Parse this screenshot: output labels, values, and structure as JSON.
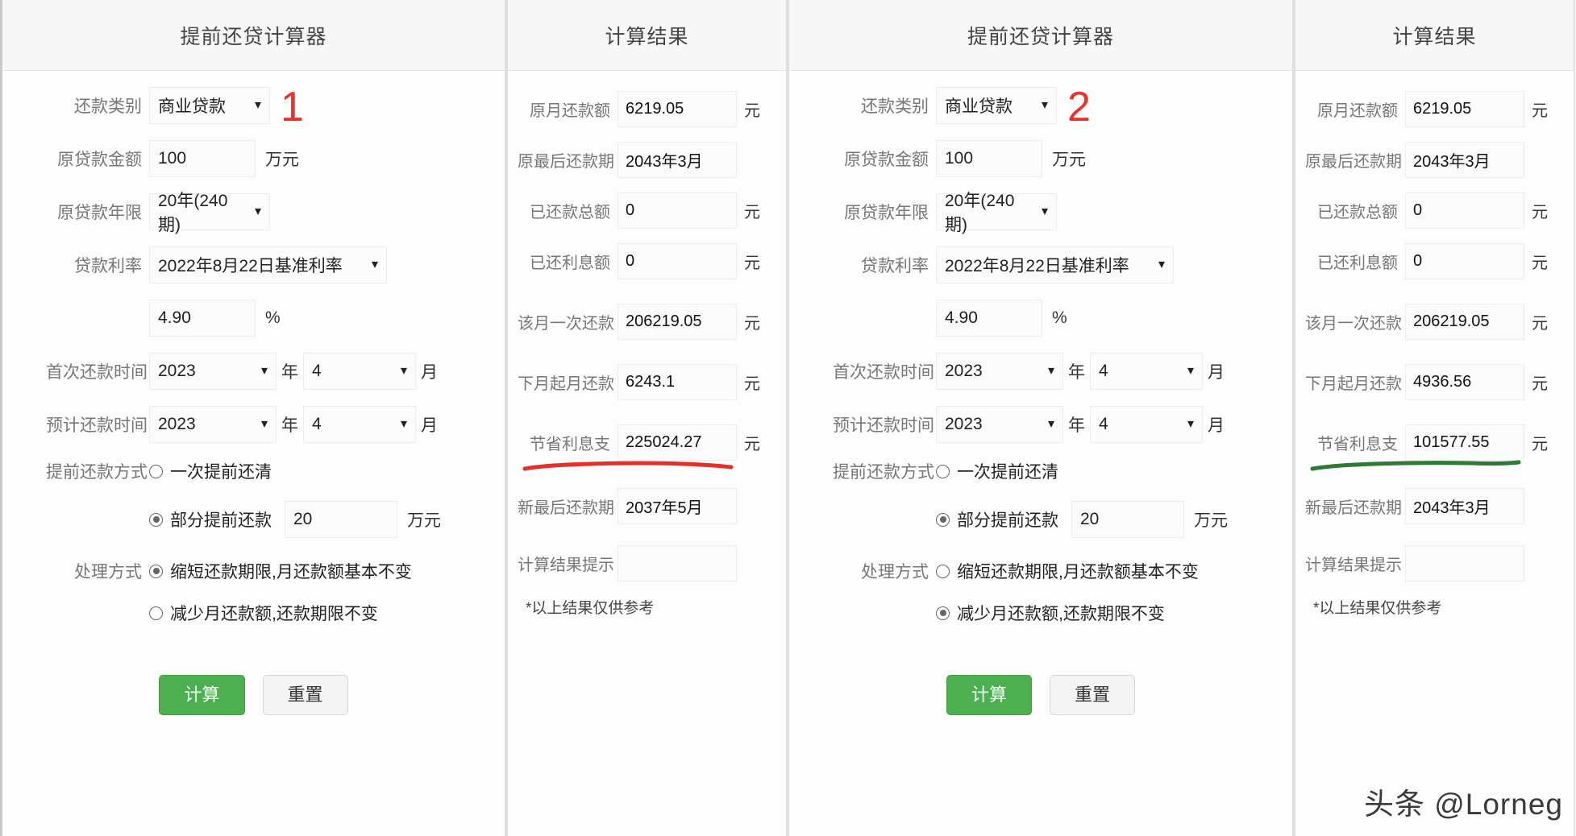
{
  "panels": [
    {
      "id": "form-1",
      "title": "提前还贷计算器",
      "marker": "1",
      "fields": {
        "category_label": "还款类别",
        "category_value": "商业贷款",
        "amount_label": "原贷款金额",
        "amount_value": "100",
        "amount_unit": "万元",
        "term_label": "原贷款年限",
        "term_value": "20年(240期)",
        "rate_label": "贷款利率",
        "rate_value": "2022年8月22日基准利率",
        "rate_pct_value": "4.90",
        "rate_pct_unit": "%",
        "first_pay_label": "首次还款时间",
        "first_pay_year": "2023",
        "first_pay_year_unit": "年",
        "first_pay_month": "4",
        "first_pay_month_unit": "月",
        "expected_pay_label": "预计还款时间",
        "expected_pay_year": "2023",
        "expected_pay_year_unit": "年",
        "expected_pay_month": "4",
        "expected_pay_month_unit": "月",
        "prepay_method_label": "提前还款方式",
        "prepay_option_full": "一次提前还清",
        "prepay_option_full_selected": false,
        "prepay_option_part": "部分提前还款",
        "prepay_option_part_selected": true,
        "prepay_part_amount": "20",
        "prepay_part_unit": "万元",
        "handle_label": "处理方式",
        "handle_option_shorten": "缩短还款期限,月还款额基本不变",
        "handle_option_shorten_selected": true,
        "handle_option_reduce": "减少月还款额,还款期限不变",
        "handle_option_reduce_selected": false,
        "calc_button": "计算",
        "reset_button": "重置"
      }
    },
    {
      "id": "form-2",
      "title": "提前还贷计算器",
      "marker": "2",
      "fields": {
        "category_label": "还款类别",
        "category_value": "商业贷款",
        "amount_label": "原贷款金额",
        "amount_value": "100",
        "amount_unit": "万元",
        "term_label": "原贷款年限",
        "term_value": "20年(240期)",
        "rate_label": "贷款利率",
        "rate_value": "2022年8月22日基准利率",
        "rate_pct_value": "4.90",
        "rate_pct_unit": "%",
        "first_pay_label": "首次还款时间",
        "first_pay_year": "2023",
        "first_pay_year_unit": "年",
        "first_pay_month": "4",
        "first_pay_month_unit": "月",
        "expected_pay_label": "预计还款时间",
        "expected_pay_year": "2023",
        "expected_pay_year_unit": "年",
        "expected_pay_month": "4",
        "expected_pay_month_unit": "月",
        "prepay_method_label": "提前还款方式",
        "prepay_option_full": "一次提前还清",
        "prepay_option_full_selected": false,
        "prepay_option_part": "部分提前还款",
        "prepay_option_part_selected": true,
        "prepay_part_amount": "20",
        "prepay_part_unit": "万元",
        "handle_label": "处理方式",
        "handle_option_shorten": "缩短还款期限,月还款额基本不变",
        "handle_option_shorten_selected": false,
        "handle_option_reduce": "减少月还款额,还款期限不变",
        "handle_option_reduce_selected": true,
        "calc_button": "计算",
        "reset_button": "重置"
      }
    }
  ],
  "results": [
    {
      "id": "result-1",
      "title": "计算结果",
      "note": "*以上结果仅供参考",
      "underline_color": "#e33127",
      "underline_after_index": 6,
      "rows": [
        {
          "label": "原月还款额",
          "value": "6219.05",
          "unit": "元"
        },
        {
          "label": "原最后还款期",
          "value": "2043年3月",
          "unit": ""
        },
        {
          "label": "已还款总额",
          "value": "0",
          "unit": "元"
        },
        {
          "label": "已还利息额",
          "value": "0",
          "unit": "元"
        },
        {
          "label": "该月一次还款",
          "value": "206219.05",
          "unit": "元"
        },
        {
          "label": "下月起月还款",
          "value": "6243.1",
          "unit": "元"
        },
        {
          "label": "节省利息支",
          "value": "225024.27",
          "unit": "元"
        },
        {
          "label": "新最后还款期",
          "value": "2037年5月",
          "unit": ""
        },
        {
          "label": "计算结果提示",
          "value": "",
          "unit": ""
        }
      ]
    },
    {
      "id": "result-2",
      "title": "计算结果",
      "note": "*以上结果仅供参考",
      "underline_color": "#2d7a33",
      "underline_after_index": 6,
      "rows": [
        {
          "label": "原月还款额",
          "value": "6219.05",
          "unit": "元"
        },
        {
          "label": "原最后还款期",
          "value": "2043年3月",
          "unit": ""
        },
        {
          "label": "已还款总额",
          "value": "0",
          "unit": "元"
        },
        {
          "label": "已还利息额",
          "value": "0",
          "unit": "元"
        },
        {
          "label": "该月一次还款",
          "value": "206219.05",
          "unit": "元"
        },
        {
          "label": "下月起月还款",
          "value": "4936.56",
          "unit": "元"
        },
        {
          "label": "节省利息支",
          "value": "101577.55",
          "unit": "元"
        },
        {
          "label": "新最后还款期",
          "value": "2043年3月",
          "unit": ""
        },
        {
          "label": "计算结果提示",
          "value": "",
          "unit": ""
        }
      ]
    }
  ],
  "watermark": "头条 @Lorneg",
  "icons": {
    "chevron_down": "⌄"
  }
}
